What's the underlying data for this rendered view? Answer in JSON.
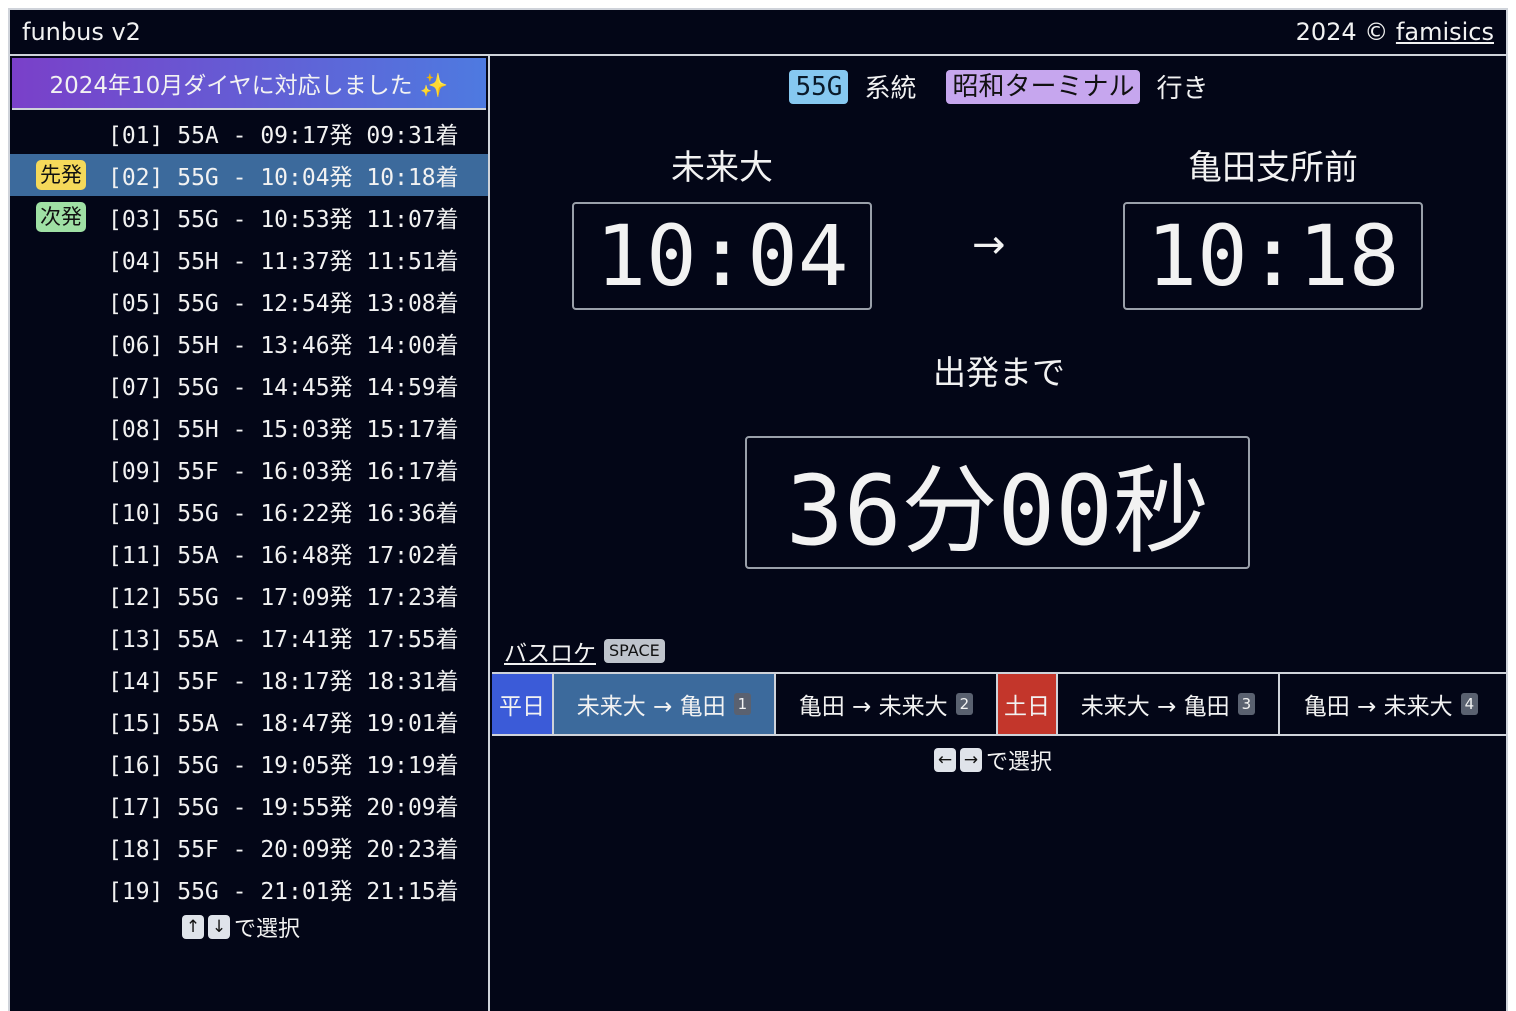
{
  "header": {
    "app_name": "funbus v2",
    "copyright": "2024 ©",
    "author_link": "famisics"
  },
  "banner": {
    "text": "2024年10月ダイヤに対応しました ✨"
  },
  "departures": [
    {
      "text": "[01] 55A - 09:17発 09:31着",
      "tag": ""
    },
    {
      "text": "[02] 55G - 10:04発 10:18着",
      "tag": "先発",
      "selected": true
    },
    {
      "text": "[03] 55G - 10:53発 11:07着",
      "tag": "次発"
    },
    {
      "text": "[04] 55H - 11:37発 11:51着",
      "tag": ""
    },
    {
      "text": "[05] 55G - 12:54発 13:08着",
      "tag": ""
    },
    {
      "text": "[06] 55H - 13:46発 14:00着",
      "tag": ""
    },
    {
      "text": "[07] 55G - 14:45発 14:59着",
      "tag": ""
    },
    {
      "text": "[08] 55H - 15:03発 15:17着",
      "tag": ""
    },
    {
      "text": "[09] 55F - 16:03発 16:17着",
      "tag": ""
    },
    {
      "text": "[10] 55G - 16:22発 16:36着",
      "tag": ""
    },
    {
      "text": "[11] 55A - 16:48発 17:02着",
      "tag": ""
    },
    {
      "text": "[12] 55G - 17:09発 17:23着",
      "tag": ""
    },
    {
      "text": "[13] 55A - 17:41発 17:55着",
      "tag": ""
    },
    {
      "text": "[14] 55F - 18:17発 18:31着",
      "tag": ""
    },
    {
      "text": "[15] 55A - 18:47発 19:01着",
      "tag": ""
    },
    {
      "text": "[16] 55G - 19:05発 19:19着",
      "tag": ""
    },
    {
      "text": "[17] 55G - 19:55発 20:09着",
      "tag": ""
    },
    {
      "text": "[18] 55F - 20:09発 20:23着",
      "tag": ""
    },
    {
      "text": "[19] 55G - 21:01発 21:15着",
      "tag": ""
    }
  ],
  "list_hint": {
    "key_up": "↑",
    "key_down": "↓",
    "label": "で選択"
  },
  "route": {
    "code": "55G",
    "system_label": "系統",
    "destination": "昭和ターミナル",
    "bound_label": "行き"
  },
  "origin": {
    "name": "未来大",
    "time": "10:04"
  },
  "arrow": "→",
  "destination": {
    "name": "亀田支所前",
    "time": "10:18"
  },
  "countdown": {
    "label": "出発まで",
    "value": "36分00秒"
  },
  "buslink": {
    "label": "バスロケ",
    "key": "SPACE"
  },
  "tabs": {
    "weekday": "平日",
    "weekend": "土日",
    "t1": {
      "label": "未来大 → 亀田",
      "num": "1"
    },
    "t2": {
      "label": "亀田 → 未来大",
      "num": "2"
    },
    "t3": {
      "label": "未来大 → 亀田",
      "num": "3"
    },
    "t4": {
      "label": "亀田 → 未来大",
      "num": "4"
    }
  },
  "tab_hint": {
    "key_left": "←",
    "key_right": "→",
    "label": "で選択"
  },
  "colors": {
    "background": "#030617",
    "selected": "#3c6a9c",
    "weekday": "#3b5bd8",
    "weekend": "#c3362b",
    "first_tag": "#f5d95a",
    "next_tag": "#9fe0a4"
  }
}
